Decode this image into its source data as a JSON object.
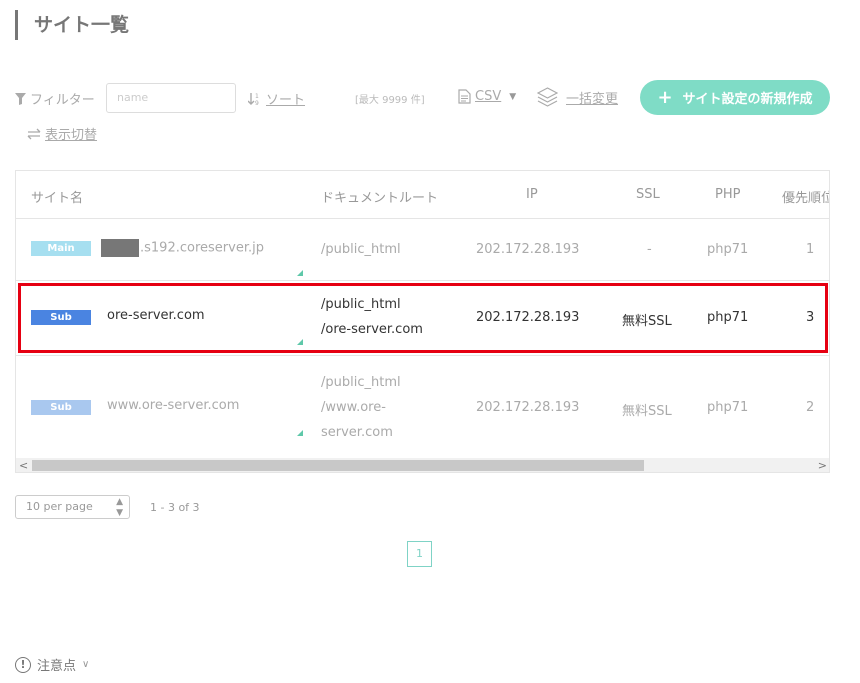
{
  "page": {
    "title": "サイト一覧"
  },
  "toolbar": {
    "filter_label": "フィルター",
    "filter_placeholder": "name",
    "sort_label": "ソート",
    "max_note": "[最大 9999 件]",
    "csv_label": "CSV",
    "bulk_change_label": "一括変更",
    "new_button_label": "サイト設定の新規作成",
    "display_toggle_label": "表示切替"
  },
  "table": {
    "headers": {
      "site_name": "サイト名",
      "doc_root": "ドキュメントルート",
      "ip": "IP",
      "ssl": "SSL",
      "php": "PHP",
      "priority": "優先順位"
    },
    "rows": [
      {
        "badge": "Main",
        "badge_color": "#a6dff0",
        "domain": ".s192.coreserver.jp",
        "doc_root_lines": [
          "/public_html"
        ],
        "ip": "202.172.28.193",
        "ssl": "-",
        "php": "php71",
        "priority": "1"
      },
      {
        "badge": "Sub",
        "badge_color": "#4a84e1",
        "domain": "ore-server.com",
        "doc_root_lines": [
          "/public_html",
          "/ore-server.com"
        ],
        "ip": "202.172.28.193",
        "ssl": "無料SSL",
        "php": "php71",
        "priority": "3"
      },
      {
        "badge": "Sub",
        "badge_color": "#a9c8ef",
        "domain": "www.ore-server.com",
        "doc_root_lines": [
          "/public_html",
          "/www.ore-",
          "server.com"
        ],
        "ip": "202.172.28.193",
        "ssl": "無料SSL",
        "php": "php71",
        "priority": "2"
      }
    ]
  },
  "pagination": {
    "per_page": "10 per page",
    "range": "1 - 3 of 3",
    "current_page": "1"
  },
  "notice": {
    "label": "注意点",
    "icon_glyph": "!"
  },
  "colors": {
    "accent": "#7fdcc6",
    "highlight": "#e60012"
  }
}
